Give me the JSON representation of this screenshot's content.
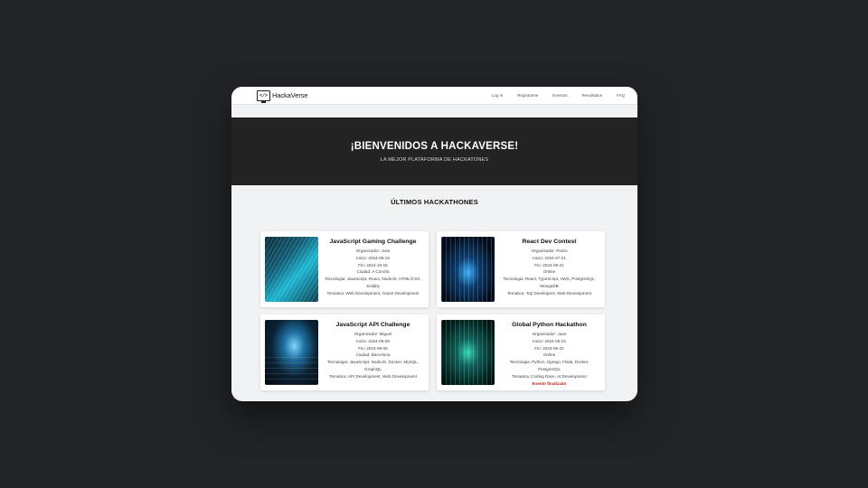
{
  "navbar": {
    "brand_icon_text": "</>",
    "brand_name": "HackaVerse",
    "links": [
      "Log in",
      "Registrarse",
      "Eventos",
      "Resultados",
      "FAQ"
    ]
  },
  "hero": {
    "title": "¡BIENVENIDOS A HACKAVERSE!",
    "subtitle": "LA MEJOR PLATAFORMA DE HACKATONES"
  },
  "section": {
    "title": "ÚLTIMOS HACKATHONES"
  },
  "cards": [
    {
      "title": "JavaScript Gaming Challenge",
      "lines": [
        "Organizador: Jose",
        "Inicio: 2024-05-15",
        "Fin: 2024-10-15",
        "Ciudad: A Coruña",
        "Tecnologia: JavaScript, React, NodeJS, HTML/CSS, Solidity",
        "Tematica: Web Development, Game Development"
      ],
      "status": ""
    },
    {
      "title": "React Dev Contest",
      "lines": [
        "Organizador: Pedro",
        "Inicio: 2024-07-21",
        "Fin: 2024-09-21",
        "Online",
        "Tecnologia: React, TypeScript, AWS, PostgreSQL, MongoDB",
        "Tematica: Top Developers, Web Development"
      ],
      "status": ""
    },
    {
      "title": "JavaScript API Challenge",
      "lines": [
        "Organizador: Miguel",
        "Inicio: 2024-06-08",
        "Fin: 2024-09-08",
        "Ciudad: Barcelona",
        "Tecnologia: JavaScript, NodeJS, Docker, MySQL, GraphQL",
        "Tematica: API Development, Web Development"
      ],
      "status": ""
    },
    {
      "title": "Global Python Hackathon",
      "lines": [
        "Organizador: Juan",
        "Inicio: 2024-05-22",
        "Fin: 2024-06-22",
        "Online",
        "Tecnologia: Python, Django, Flask, Docker, PostgreSQL",
        "Tematica: Coding Race, AI Development"
      ],
      "status": "Evento finalizado"
    }
  ],
  "colors": {
    "page_background": "#232427",
    "hero_background": "#232323",
    "finished_status": "#c0211a"
  }
}
